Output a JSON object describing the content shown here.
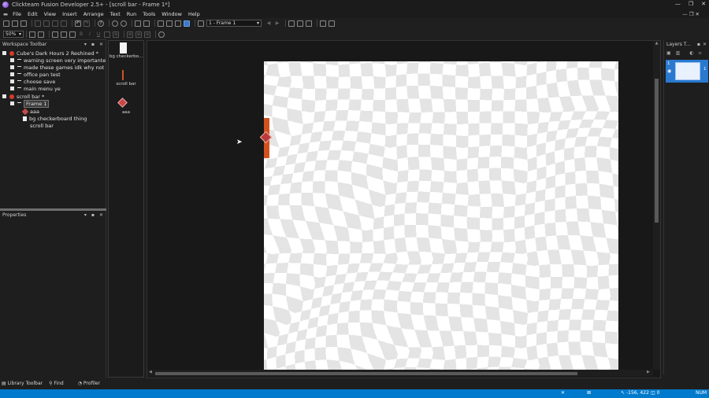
{
  "window": {
    "title": "Clickteam Fusion Developer 2.5+ - [scroll bar - Frame 1*]",
    "min": "—",
    "max": "❐",
    "close": "✕"
  },
  "menu": [
    "File",
    "Edit",
    "View",
    "Insert",
    "Arrange",
    "Text",
    "Run",
    "Tools",
    "Window",
    "Help"
  ],
  "toolbar": {
    "frame_select": "1 - Frame 1",
    "zoom": "50%"
  },
  "workspace": {
    "title": "Workspace Toolbar",
    "items": [
      "Cube's Dark Hours 2 Reshined *",
      "warning screen very importante",
      "made these games idk why not",
      "office pan test",
      "choose save",
      "main menu ye",
      "scroll bar *",
      "Frame 1",
      "aaa",
      "bg checkerboard thing",
      "scroll bar"
    ]
  },
  "properties": {
    "title": "Properties"
  },
  "object_shelf": {
    "items": [
      "bg checkerbo...",
      "scroll bar",
      "aaa"
    ]
  },
  "layers": {
    "title": "Layers T...",
    "layer_index": "1"
  },
  "bottom_tabs": {
    "library": "Library Toolbar",
    "find": "Find",
    "profiler": "Profiler"
  },
  "status": {
    "coords": "-156, 422",
    "count": "0",
    "num": "NUM"
  },
  "colors": {
    "accent": "#007acc",
    "panel": "#1e1e1e",
    "scrollbar_orange": "#d2521f"
  }
}
